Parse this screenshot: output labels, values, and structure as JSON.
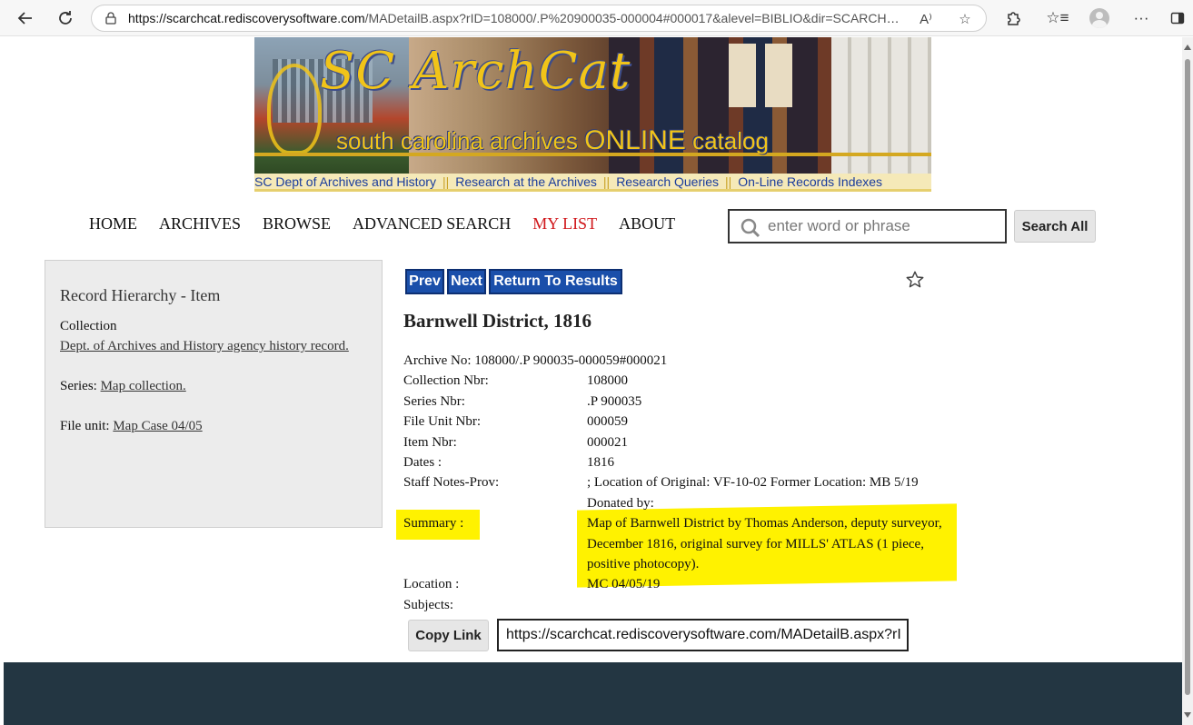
{
  "browser": {
    "url": "https://scarchcat.rediscoverysoftware.com/MADetailB.aspx?rID=108000/.P%20900035-000004#000017&alevel=BIBLIO&dir=SCARCHIV...",
    "url_host": "https://scarchcat.rediscoverysoftware.com",
    "url_rest": "/MADetailB.aspx?rID=108000/.P%20900035-000004#000017&alevel=BIBLIO&dir=SCARCHIV...",
    "icons": [
      "back-icon",
      "refresh-icon",
      "lock-icon",
      "read-aloud-icon",
      "favorite-icon",
      "extensions-icon",
      "favorites-list-icon",
      "profile-icon",
      "more-icon",
      "sidebar-icon"
    ]
  },
  "banner": {
    "logo_text": "SC ArchCat",
    "tagline_prefix": "south carolina archives",
    "tagline_online": "ONLINE",
    "tagline_suffix": "catalog",
    "links": [
      "SC Dept of Archives and History",
      "Research at the Archives",
      "Research Queries",
      "On-Line Records Indexes"
    ],
    "separator": "||"
  },
  "nav": {
    "items": [
      "HOME",
      "ARCHIVES",
      "BROWSE",
      "ADVANCED SEARCH",
      "MY LIST",
      "ABOUT"
    ],
    "active_color": "#d0171b",
    "search_placeholder": "enter word or phrase",
    "search_button": "Search All"
  },
  "hierarchy": {
    "title": "Record Hierarchy - Item",
    "collection_label": "Collection",
    "collection_link": "Dept. of Archives and History agency history record.",
    "series_label": "Series:",
    "series_link": "Map collection.",
    "file_unit_label": "File unit:",
    "file_unit_link": "Map Case 04/05"
  },
  "record": {
    "buttons": {
      "prev": "Prev",
      "next": "Next",
      "return": "Return To Results"
    },
    "title": "Barnwell District, 1816",
    "archive_no": "Archive No: 108000/.P 900035-000059#000021",
    "fields": [
      {
        "label": "Collection Nbr:",
        "value": "108000"
      },
      {
        "label": "Series Nbr:",
        "value": ".P 900035"
      },
      {
        "label": "File Unit Nbr:",
        "value": "000059"
      },
      {
        "label": "Item Nbr:",
        "value": "000021"
      },
      {
        "label": "Dates :",
        "value": "1816"
      },
      {
        "label": "Staff Notes-Prov:",
        "value": "; Location of Original: VF-10-02 Former Location: MB 5/19 Donated by:"
      },
      {
        "label": "Summary :",
        "value": "Map of Barnwell District by Thomas Anderson, deputy surveyor, December 1816, original survey for MILLS' ATLAS (1 piece, positive photocopy)."
      },
      {
        "label": "Location :",
        "value": "MC 04/05/19"
      },
      {
        "label": "Subjects:",
        "value": ""
      }
    ],
    "highlight_color": "#fff200",
    "copy_button": "Copy Link",
    "copy_link_value": "https://scarchcat.rediscoverysoftware.com/MADetailB.aspx?rI"
  },
  "colors": {
    "nav_button": "#1a4faa",
    "footer": "#233642",
    "link_bar": "#f5e9b8"
  }
}
